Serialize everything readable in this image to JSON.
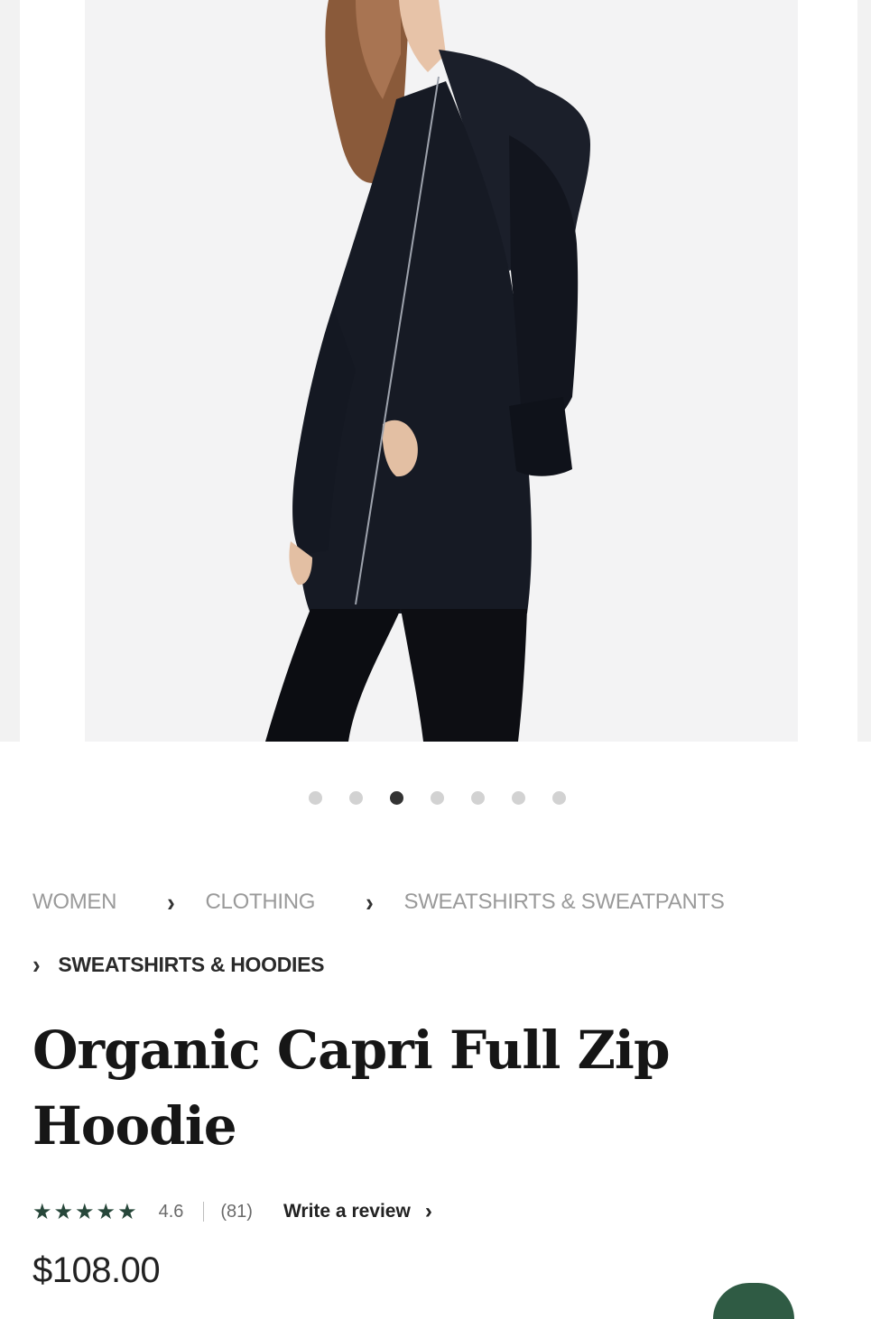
{
  "gallery": {
    "image_description": "product-photo",
    "dots_count": 7,
    "active_dot_index": 2
  },
  "breadcrumb": {
    "items": [
      "WOMEN",
      "CLOTHING",
      "SWEATSHIRTS & SWEATPANTS"
    ],
    "current": "SWEATSHIRTS & HOODIES"
  },
  "product": {
    "title_line1": "Organic Capri Full Zip",
    "title_line2": "Hoodie",
    "rating_stars": "★★★★★",
    "rating_value": "4.6",
    "review_count": "(81)",
    "write_review_label": "Write a review",
    "price": "$108.00"
  },
  "colors": {
    "star_color": "#27473a",
    "brand_green": "#2f5b44",
    "photo_bg": "#f3f3f4"
  }
}
